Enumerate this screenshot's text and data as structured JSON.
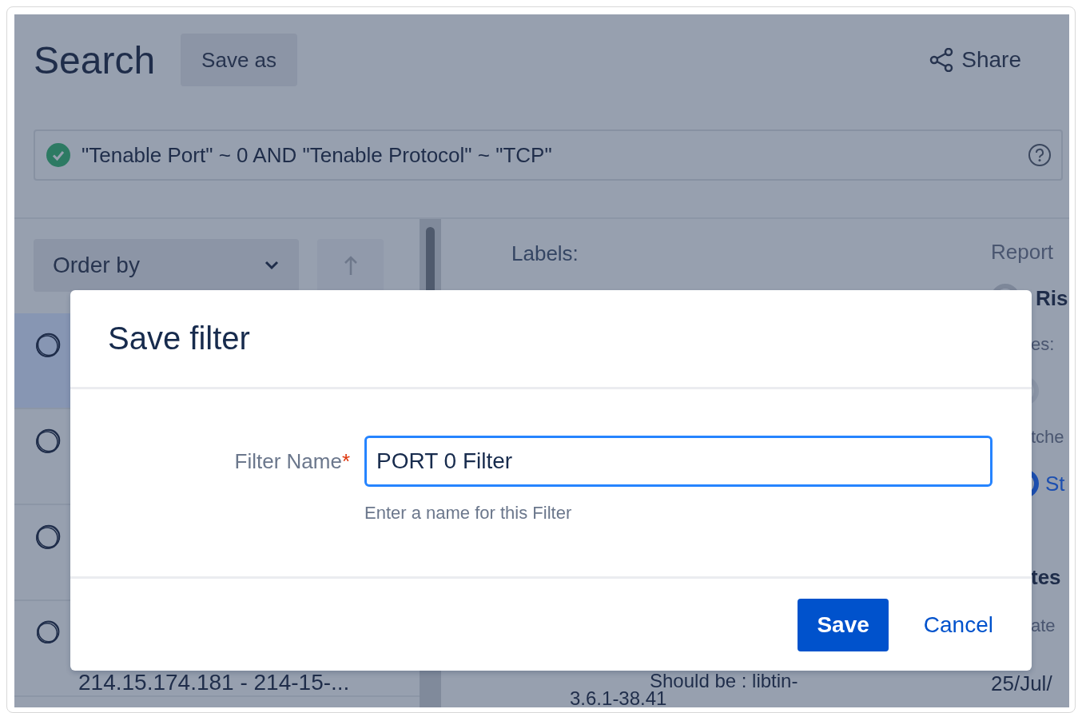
{
  "header": {
    "title": "Search",
    "save_as": "Save as",
    "share": "Share"
  },
  "query": {
    "valid": true,
    "text": "\"Tenable Port\" ~ 0 AND \"Tenable Protocol\" ~ \"TCP\""
  },
  "order_by": {
    "label": "Order by"
  },
  "results": [
    {
      "selected": true
    },
    {
      "selected": false
    },
    {
      "selected": false
    },
    {
      "selected": false,
      "subtitle": "214.15.174.181 - 214-15-..."
    }
  ],
  "detail": {
    "labels_heading": "Labels:",
    "text_lines": [
      "Should be : libtin-",
      "3.6.1-38.41"
    ]
  },
  "side": [
    {
      "kind": "heading",
      "text": "Report"
    },
    {
      "kind": "radio",
      "text": "Ris"
    },
    {
      "kind": "fragment",
      "text": "es:"
    },
    {
      "kind": "dot"
    },
    {
      "kind": "fragment",
      "text": "tche"
    },
    {
      "kind": "link",
      "text": "St"
    },
    {
      "kind": "bold",
      "text": "tes"
    },
    {
      "kind": "fragment",
      "text": "ate"
    },
    {
      "kind": "value",
      "text": "25/Jul/"
    }
  ],
  "dialog": {
    "title": "Save filter",
    "field_label": "Filter Name",
    "required": true,
    "required_mark": "*",
    "value": "PORT 0 Filter",
    "hint": "Enter a name for this Filter",
    "buttons": [
      {
        "label": "Save",
        "primary": true
      },
      {
        "label": "Cancel",
        "primary": false
      }
    ]
  }
}
